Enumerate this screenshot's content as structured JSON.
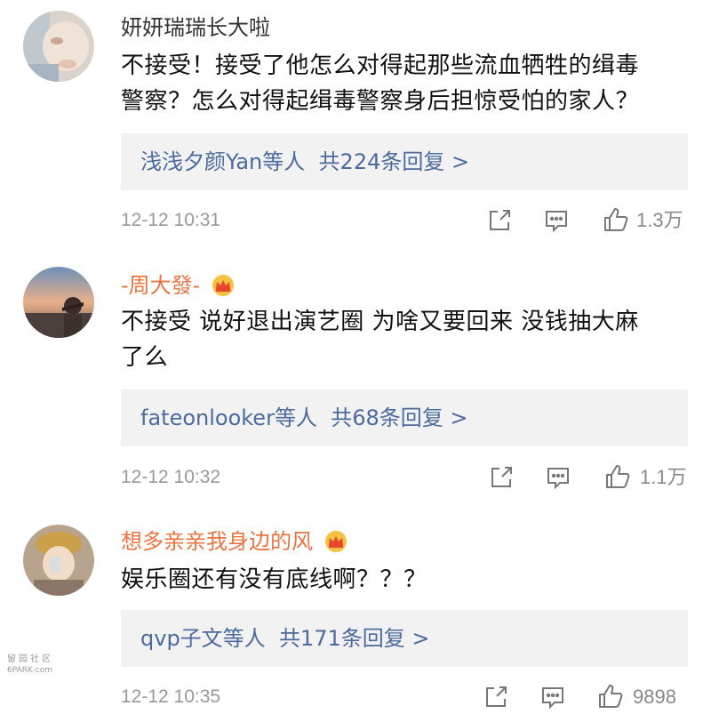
{
  "comments": [
    {
      "username": "妍妍瑞瑞长大啦",
      "vip": false,
      "text_lines": [
        "不接受！接受了他怎么对得起那些流血牺牲的缉毒",
        "警察？怎么对得起缉毒警察身后担惊受怕的家人？"
      ],
      "reply_users": "浅浅夕颜Yan等人",
      "reply_count": "共224条回复 >",
      "time": "12-12 10:31",
      "likes": "1.3万"
    },
    {
      "username": "-周大發-",
      "vip": true,
      "text_lines": [
        "不接受 说好退出演艺圈 为啥又要回来 没钱抽大麻",
        "了么"
      ],
      "reply_users": "fateonlooker等人",
      "reply_count": "共68条回复 >",
      "time": "12-12 10:32",
      "likes": "1.1万"
    },
    {
      "username": "想多亲亲我身边的风",
      "vip": true,
      "text_lines": [
        "娱乐圈还有没有底线啊？？？"
      ],
      "reply_users": "qvp子文等人",
      "reply_count": "共171条回复 >",
      "time": "12-12 10:35",
      "likes": "9898"
    }
  ],
  "icons": {
    "share": "share-icon",
    "comment": "comment-icon",
    "like": "thumbs-up-icon",
    "vip": "crown-icon"
  },
  "colors": {
    "vip_name": "#eb7340",
    "reply_link": "#4d6a9e",
    "reply_bg": "#f2f2f2",
    "meta": "#999999"
  },
  "watermark": {
    "line1": "留园社区",
    "line2": "6PARK·com"
  }
}
